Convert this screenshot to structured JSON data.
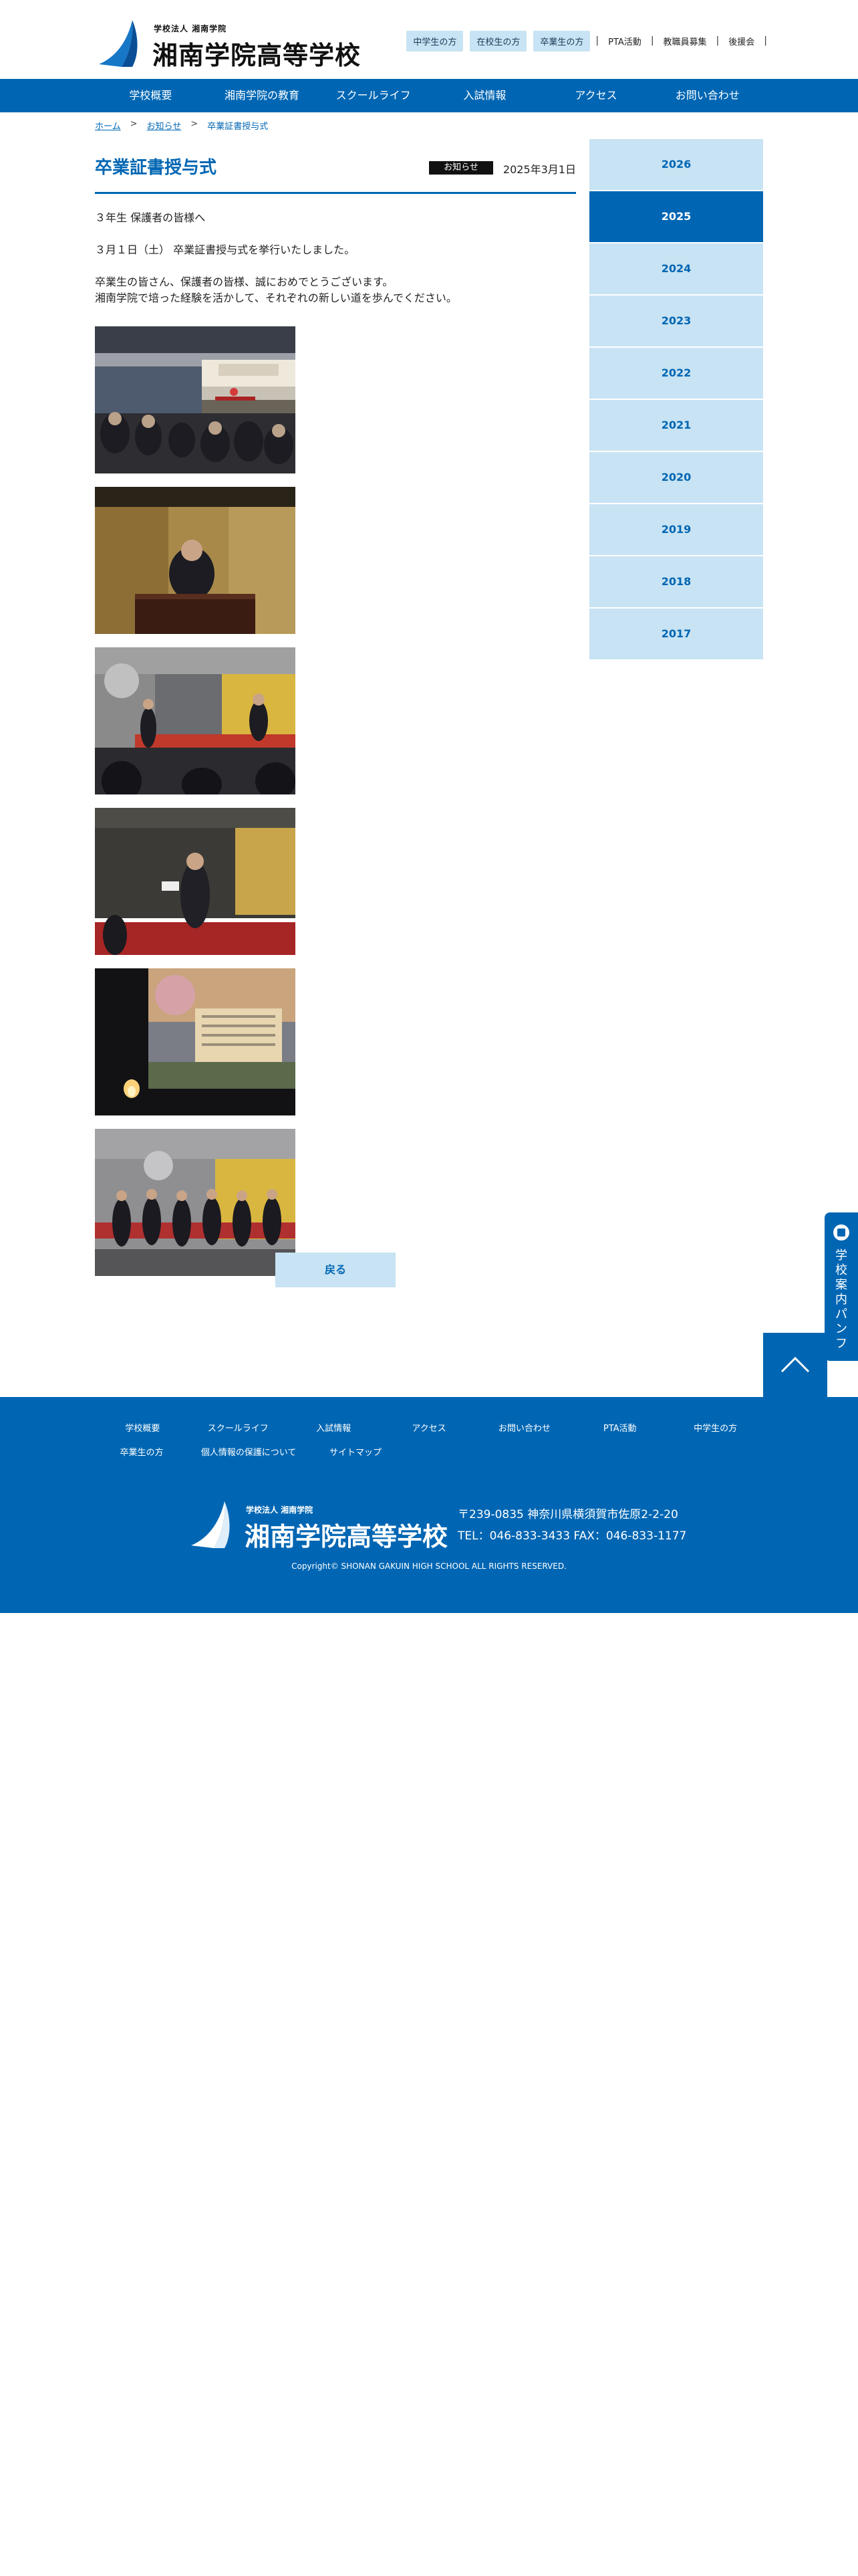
{
  "header": {
    "logo_small": "学校法人 湘南学院",
    "logo_main": "湘南学院高等学校",
    "top_links": {
      "junior_high": "中学生の方",
      "current_students": "在校生の方",
      "graduates": "卒業生の方",
      "pta": "PTA活動",
      "recruit": "教職員募集",
      "alumni": "後援会"
    }
  },
  "main_nav": [
    "学校概要",
    "湘南学院の教育",
    "スクールライフ",
    "入試情報",
    "アクセス",
    "お問い合わせ"
  ],
  "breadcrumb": {
    "home": "ホーム",
    "news": "お知らせ",
    "current": "卒業証書授与式"
  },
  "article": {
    "title": "卒業証書授与式",
    "category": "お知らせ",
    "date": "2025年3月1日",
    "paragraph1": "３年生 保護者の皆様へ",
    "paragraph2": "３月１日（土） 卒業証書授与式を挙行いたしました。",
    "paragraph3_line1": "卒業生の皆さん、保護者の皆様、誠におめでとうございます。",
    "paragraph3_line2": "湘南学院で培った経験を活かして、それぞれの新しい道を歩んでください。",
    "back_button": "戻る"
  },
  "sidebar_years": [
    "2026",
    "2025",
    "2024",
    "2023",
    "2022",
    "2021",
    "2020",
    "2019",
    "2018",
    "2017"
  ],
  "sidebar_active": "2025",
  "floating": {
    "pamphlet": "学校案内パンフ"
  },
  "footer": {
    "nav_row1": [
      "学校概要",
      "スクールライフ",
      "入試情報",
      "アクセス",
      "お問い合わせ",
      "PTA活動",
      "中学生の方"
    ],
    "nav_row2": [
      "卒業生の方",
      "個人情報の保護について",
      "サイトマップ"
    ],
    "address": "〒239-0835 神奈川県横須賀市佐原2-2-20",
    "tel_fax": "TEL：046-833-3433 FAX：046-833-1177",
    "copyright": "Copyright© SHONAN GAKUIN HIGH SCHOOL ALL RIGHTS RESERVED."
  },
  "colors": {
    "brand_blue": "#0066b3",
    "light_blue": "#c8e3f3"
  }
}
